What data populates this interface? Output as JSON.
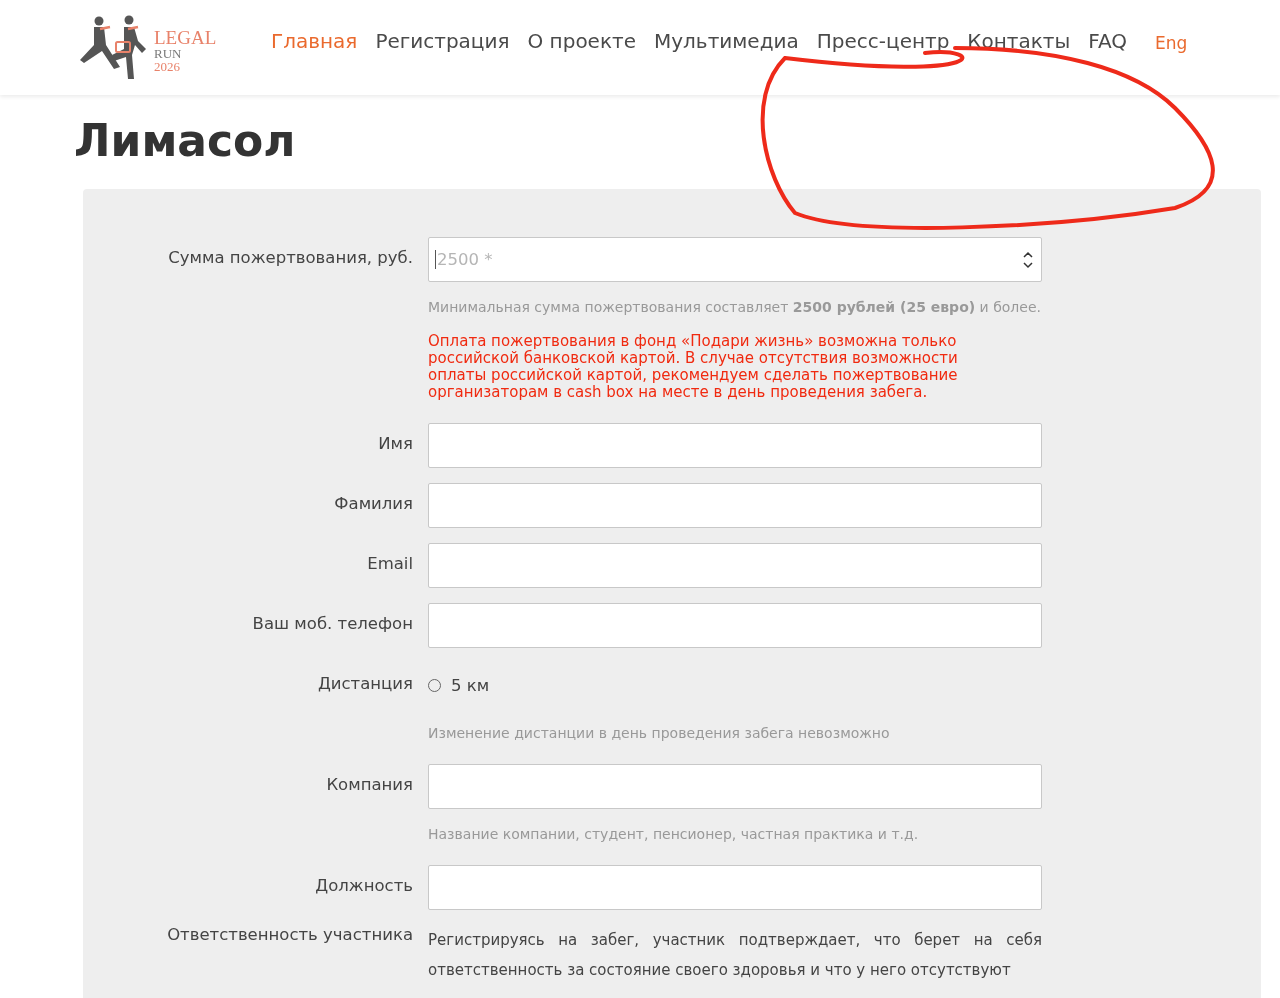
{
  "header": {
    "logo": {
      "line1": "LEGAL",
      "line2": "RUN",
      "line3": "2026"
    },
    "nav": [
      {
        "label": "Главная",
        "selected": true
      },
      {
        "label": "Регистрация",
        "selected": false
      },
      {
        "label": "О проекте",
        "selected": false
      },
      {
        "label": "Мультимедиа",
        "selected": false
      },
      {
        "label": "Пресс-центр",
        "selected": false
      },
      {
        "label": "Контакты",
        "selected": false
      },
      {
        "label": "FAQ",
        "selected": false
      }
    ],
    "lang": "Eng"
  },
  "title": "Лимасол",
  "form": {
    "fields": [
      {
        "kind": "number",
        "label": "Сумма пожертвования, руб.",
        "placeholder": "2500 *",
        "hint": "Минимальная сумма пожертвования составляет **2500 рублей (25 евро)** и более.",
        "warning": "Оплата пожертвования в фонд «Подари жизнь» возможна только российской банковской картой. В случае отсутствия возможности оплаты российской картой, рекомендуем сделать пожертвование организаторам в cash box на месте в день проведения забега."
      },
      {
        "kind": "text",
        "label": "Имя"
      },
      {
        "kind": "text",
        "label": "Фамилия"
      },
      {
        "kind": "text",
        "label": "Email"
      },
      {
        "kind": "text",
        "label": "Ваш моб. телефон"
      },
      {
        "kind": "radio",
        "label": "Дистанция",
        "options": [
          {
            "label": "5 км",
            "selected": false
          }
        ],
        "hint": "Изменение дистанции в день проведения забега невозможно"
      },
      {
        "kind": "text",
        "label": "Компания",
        "hint": "Название компании, студент, пенсионер, частная практика и т.д."
      },
      {
        "kind": "text",
        "label": "Должность"
      },
      {
        "kind": "statement",
        "label": "Ответственность участника",
        "text": "Регистрируясь на забег, участник подтверждает, что берет на себя ответственность за состояние своего здоровья и что у него отсутствуют"
      }
    ]
  }
}
